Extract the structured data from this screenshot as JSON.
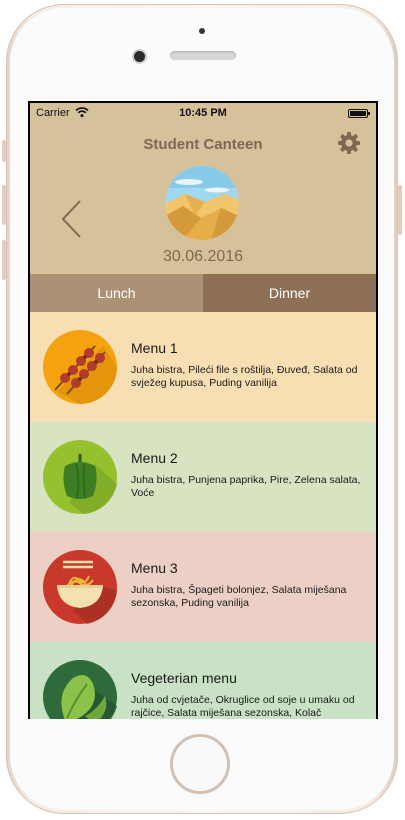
{
  "status_bar": {
    "carrier": "Carrier",
    "time": "10:45 PM"
  },
  "header": {
    "title": "Student Canteen",
    "date": "30.06.2016"
  },
  "tabs": [
    {
      "label": "Lunch",
      "selected": false
    },
    {
      "label": "Dinner",
      "selected": true
    }
  ],
  "menus": [
    {
      "name": "Menu 1",
      "description": "Juha bistra, Pileći file s roštilja, Đuveđ, Salata od svježeg kupusa, Puding vanilija",
      "icon": "skewer-icon",
      "bg": "#f7dfb3",
      "icon_bg": "#f4a30f"
    },
    {
      "name": "Menu 2",
      "description": "Juha bistra, Punjena paprika, Pire, Zelena salata, Voće",
      "icon": "pepper-icon",
      "bg": "#d8e3c2",
      "icon_bg": "#96c12f"
    },
    {
      "name": "Menu 3",
      "description": "Juha bistra, Špageti bolonjez, Salata miješana sezonska, Puding vanilija",
      "icon": "noodle-bowl-icon",
      "bg": "#ecd0c6",
      "icon_bg": "#c8392b"
    },
    {
      "name": "Vegeterian menu",
      "description": "Juha od cvjetače, Okruglice od soje u umaku od rajčice, Salata miješana sezonska, Kolač",
      "icon": "leaf-icon",
      "bg": "#c9e1c5",
      "icon_bg": "#2f6a3b"
    }
  ]
}
